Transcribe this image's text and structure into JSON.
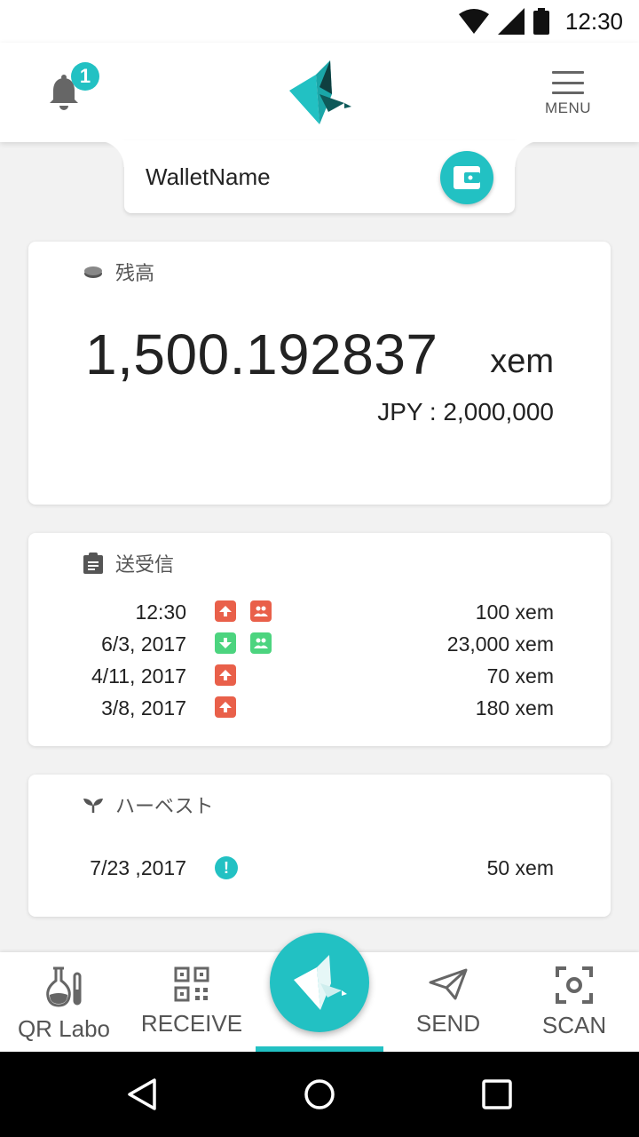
{
  "status_bar": {
    "time": "12:30"
  },
  "header": {
    "notification_count": "1",
    "menu_label": "MENU"
  },
  "wallet": {
    "name": "WalletName"
  },
  "balance": {
    "title": "残高",
    "amount": "1,500.192837",
    "unit": "xem",
    "fiat": "JPY : 2,000,000"
  },
  "transactions": {
    "title": "送受信",
    "rows": [
      {
        "date": "12:30",
        "amount": "100 xem",
        "direction": "send-icon",
        "multisig": true
      },
      {
        "date": "6/3, 2017",
        "amount": "23,000 xem",
        "direction": "receive-icon",
        "multisig": true
      },
      {
        "date": "4/11, 2017",
        "amount": "70 xem",
        "direction": "send-icon",
        "multisig": false
      },
      {
        "date": "3/8, 2017",
        "amount": "180 xem",
        "direction": "send-icon",
        "multisig": false
      }
    ]
  },
  "harvest": {
    "title": "ハーベスト",
    "rows": [
      {
        "date": "7/23 ,2017",
        "amount": "50 xem"
      }
    ]
  },
  "bottom_nav": {
    "qr_labo": "QR Labo",
    "receive": "RECEIVE",
    "send": "SEND",
    "scan": "SCAN"
  },
  "colors": {
    "accent": "#22c1c3",
    "send": "#e9604a",
    "receive": "#4cd47f"
  }
}
